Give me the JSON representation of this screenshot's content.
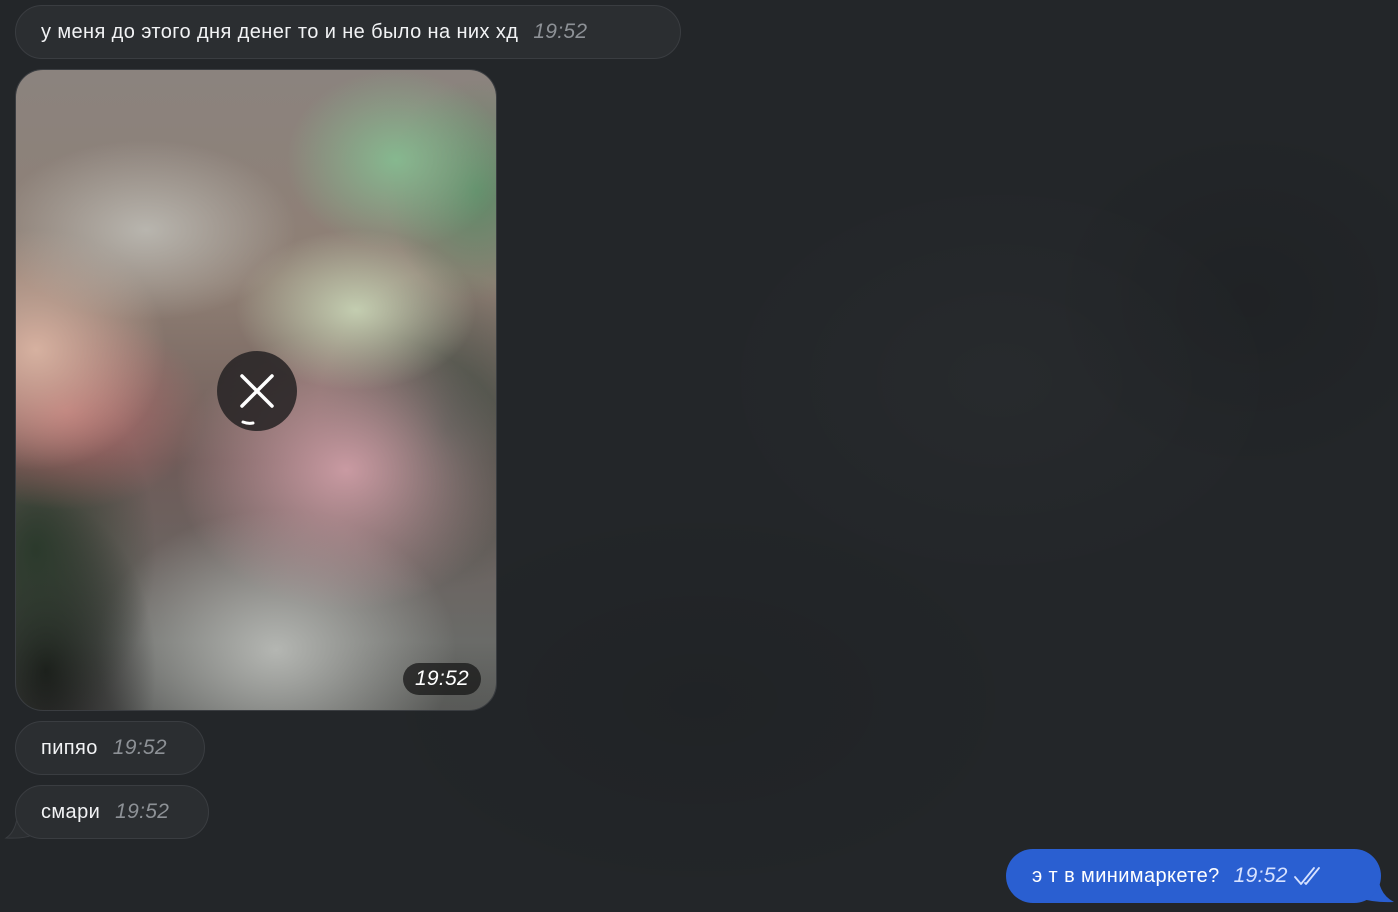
{
  "messages": [
    {
      "direction": "incoming",
      "text": "у меня до этого дня денег то и не было на них хд",
      "time": "19:52"
    },
    {
      "direction": "incoming",
      "type": "photo",
      "status": "loading",
      "time": "19:52"
    },
    {
      "direction": "incoming",
      "text": "пипяо",
      "time": "19:52"
    },
    {
      "direction": "incoming",
      "text": "смари",
      "time": "19:52"
    },
    {
      "direction": "outgoing",
      "text": "э т в минимаркете?",
      "time": "19:52",
      "read_status_icon": "double-check-icon"
    }
  ],
  "colors": {
    "background": "#232629",
    "incoming_bubble": "#2b2e31",
    "outgoing_bubble": "#2a5fd1",
    "timestamp": "#8d9196"
  }
}
